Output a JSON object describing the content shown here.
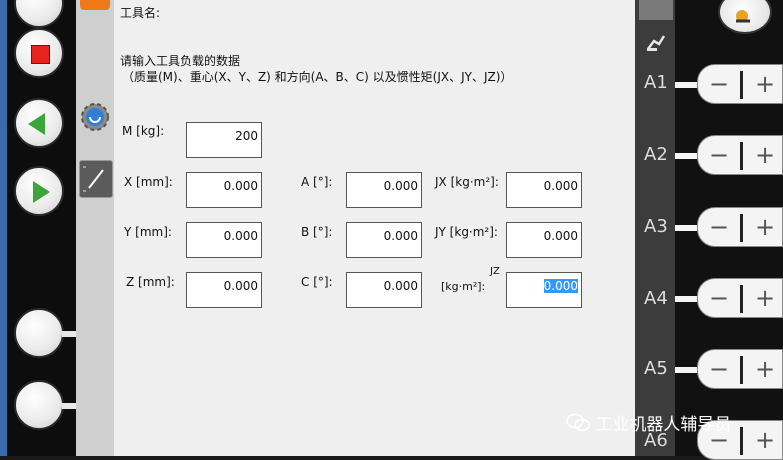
{
  "panel": {
    "tool_name_label": "工具名:",
    "prompt_line1": "请输入工具负载的数据",
    "prompt_line2": "（质量(M)、重心(X、Y、Z) 和方向(A、B、C) 以及惯性矩(JX、JY、JZ)）"
  },
  "fields": {
    "m": {
      "label": "M [kg]:",
      "value": "200"
    },
    "x": {
      "label": "X [mm]:",
      "value": "0.000"
    },
    "y": {
      "label": "Y [mm]:",
      "value": "0.000"
    },
    "z": {
      "label": "Z [mm]:",
      "value": "0.000"
    },
    "a": {
      "label": "A [°]:",
      "value": "0.000"
    },
    "b": {
      "label": "B [°]:",
      "value": "0.000"
    },
    "c": {
      "label": "C [°]:",
      "value": "0.000"
    },
    "jx": {
      "label": "JX [kg·m²]:",
      "value": "0.000"
    },
    "jy": {
      "label": "JY [kg·m²]:",
      "value": "0.000"
    },
    "jz": {
      "label_top": "JZ",
      "label_bottom": "[kg·m²]:",
      "value": "0.000"
    }
  },
  "axes": [
    "A1",
    "A2",
    "A3",
    "A4",
    "A5",
    "A6"
  ],
  "jog": {
    "minus": "−",
    "plus": "+"
  },
  "watermark": "工业机器人辅导员",
  "colors": {
    "stop": "#e8241e",
    "play": "#3aa63a",
    "tab_active": "#f07a1a",
    "selection": "#3399ff"
  },
  "icons": [
    "stop-icon",
    "back-icon",
    "play-icon",
    "tool-gear-icon",
    "clock-icon",
    "robot-icon",
    "wechat-icon"
  ]
}
